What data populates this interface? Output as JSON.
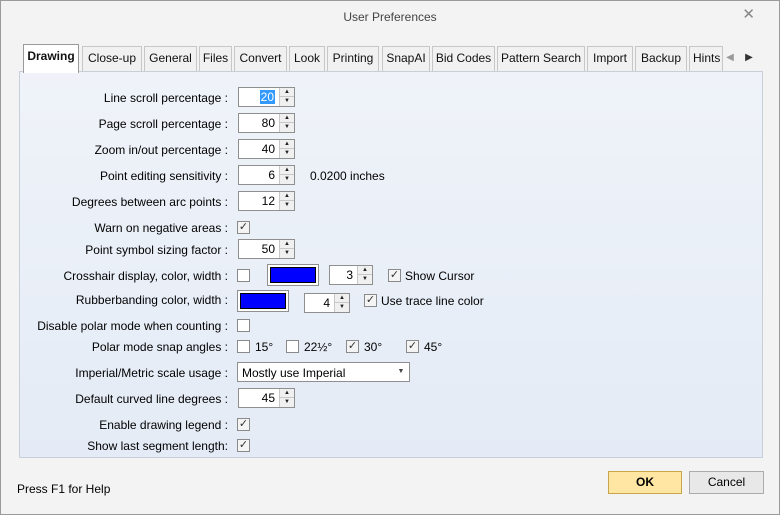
{
  "window": {
    "title": "User Preferences",
    "close_glyph": "✕"
  },
  "tabs": [
    {
      "label": "Drawing",
      "active": true
    },
    {
      "label": "Close-up"
    },
    {
      "label": "General"
    },
    {
      "label": "Files"
    },
    {
      "label": "Convert"
    },
    {
      "label": "Look"
    },
    {
      "label": "Printing"
    },
    {
      "label": "SnapAI"
    },
    {
      "label": "Bid Codes"
    },
    {
      "label": "Pattern Search"
    },
    {
      "label": "Import"
    },
    {
      "label": "Backup"
    },
    {
      "label": "Hints"
    }
  ],
  "tab_scroll": {
    "left_glyph": "◀",
    "right_glyph": "▶"
  },
  "spin_glyphs": {
    "up": "▲",
    "down": "▼"
  },
  "check_glyph": "✓",
  "combo_glyph": "▼",
  "form": {
    "line_scroll": {
      "label": "Line scroll percentage :",
      "value": "20"
    },
    "page_scroll": {
      "label": "Page scroll percentage :",
      "value": "80"
    },
    "zoom": {
      "label": "Zoom in/out percentage :",
      "value": "40"
    },
    "point_edit": {
      "label": "Point editing sensitivity :",
      "value": "6",
      "unit_text": "0.0200 inches"
    },
    "arc_points": {
      "label": "Degrees between arc points :",
      "value": "12"
    },
    "warn_negative": {
      "label": "Warn on negative areas :",
      "checked": true
    },
    "symbol_size": {
      "label": "Point symbol sizing factor :",
      "value": "50"
    },
    "crosshair": {
      "label": "Crosshair display, color, width :",
      "checked": false,
      "color": "#0000ff",
      "width": "3",
      "show_cursor_label": "Show Cursor",
      "show_cursor_checked": true
    },
    "rubberband": {
      "label": "Rubberbanding color, width :",
      "color": "#0000ff",
      "width": "4",
      "trace_label": "Use trace line color",
      "trace_checked": true
    },
    "polar_count": {
      "label": "Disable polar mode when counting :",
      "checked": false
    },
    "polar_snap": {
      "label": "Polar mode snap angles :",
      "options": [
        {
          "label": "15°",
          "checked": false
        },
        {
          "label": "22½°",
          "checked": false
        },
        {
          "label": "30°",
          "checked": true
        },
        {
          "label": "45°",
          "checked": true
        }
      ]
    },
    "scale_usage": {
      "label": "Imperial/Metric scale usage :",
      "value": "Mostly use Imperial"
    },
    "curved_degrees": {
      "label": "Default curved line degrees :",
      "value": "45"
    },
    "drawing_legend": {
      "label": "Enable drawing legend :",
      "checked": true
    },
    "last_segment": {
      "label": "Show last segment length:",
      "checked": true
    }
  },
  "footer": {
    "help": "Press F1 for Help",
    "ok": "OK",
    "cancel": "Cancel"
  },
  "colors": {
    "accent_ok": "#ffe7a3",
    "selection": "#3399ff"
  }
}
